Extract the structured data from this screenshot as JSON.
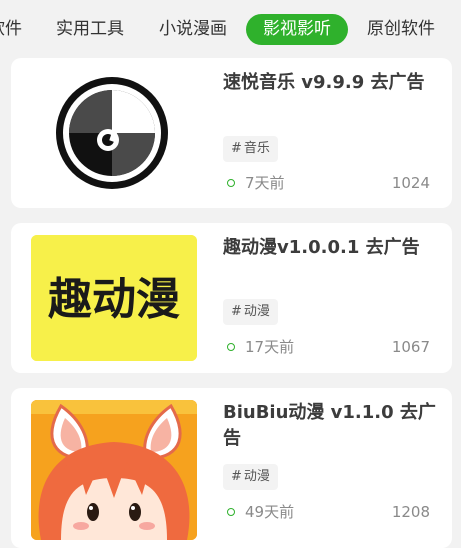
{
  "tabs": [
    {
      "label": "软件"
    },
    {
      "label": "实用工具"
    },
    {
      "label": "小说漫画"
    },
    {
      "label": "影视影听"
    },
    {
      "label": "原创软件"
    }
  ],
  "active_tab": "影视影听",
  "accent_color": "#2fb12c",
  "items": [
    {
      "title": "速悦音乐 v9.9.9 去广告",
      "tag": "音乐",
      "time": "7天前",
      "count": "1024",
      "icon": "vinyl-music-logo"
    },
    {
      "title": "趣动漫v1.0.0.1 去广告",
      "tag": "动漫",
      "time": "17天前",
      "count": "1067",
      "icon": "qudongman-logo",
      "logo_text": "趣动漫"
    },
    {
      "title": "BiuBiu动漫 v1.1.0 去广告",
      "tag": "动漫",
      "time": "49天前",
      "count": "1208",
      "icon": "anime-bunny-girl-logo"
    }
  ]
}
